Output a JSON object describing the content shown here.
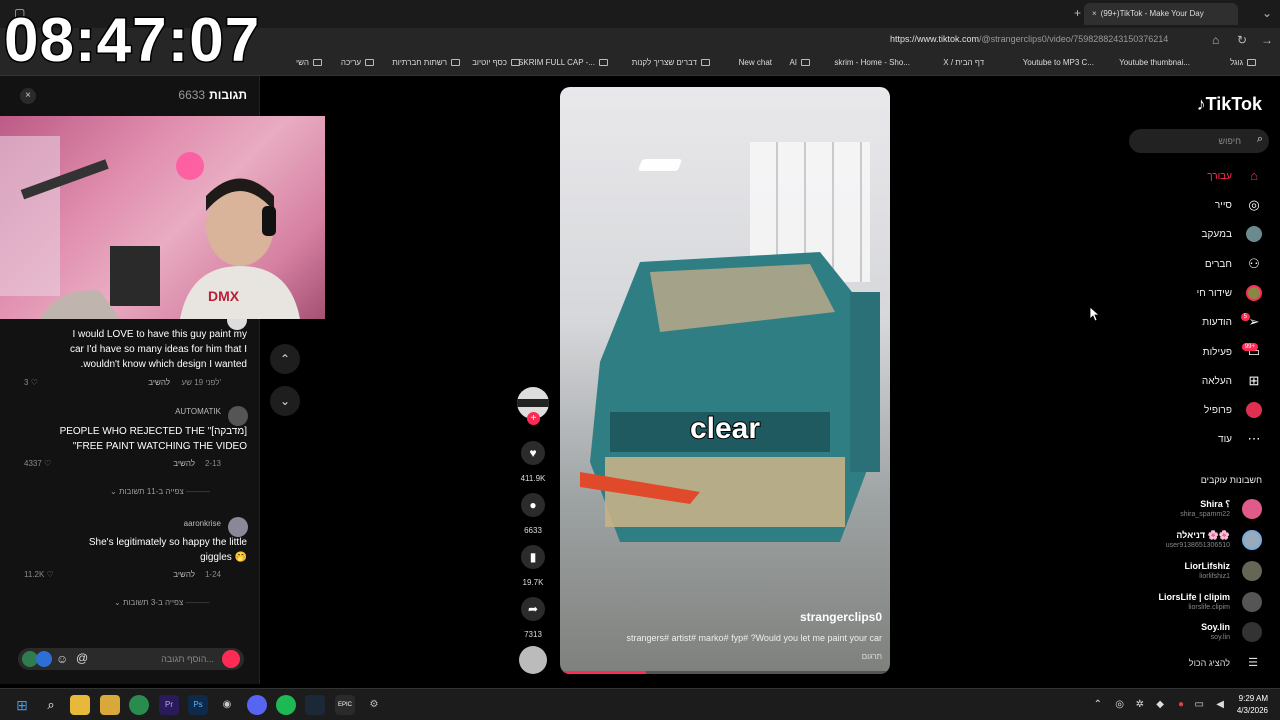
{
  "clock": "08:47:07",
  "browser": {
    "tab_title": "(99+)TikTok - Make Your Day",
    "url_host": "https://www.tiktok.com",
    "url_path": "/@strangerclips0/video/7598288243150376214",
    "bookmarks": [
      "גוגל",
      "Youtube thumbnai...",
      "Youtube to MP3 C...",
      "X / דף הבית",
      "skrim - Home - Sho...",
      "AI",
      "New chat",
      "דברים שצריך לקנות",
      "SKRIM FULL CAP -...",
      "כסף יוטיוב",
      "רשתות חברתיות",
      "עריכה",
      "השי"
    ]
  },
  "comments": {
    "title": "תגובות",
    "count": "6633",
    "close": "×",
    "items": [
      {
        "text_lines": [
          "I would LOVE to have this guy paint my",
          "car I'd have so many ideas for him that I",
          ".wouldn't know which design I wanted"
        ],
        "time": "לפני 19 שע'",
        "reply": "להשיב",
        "likes": "3"
      },
      {
        "user": "AUTOMATIK",
        "text_lines": [
          "PEOPLE WHO REJECTED THE \"[מדבקה]",
          "\"FREE PAINT WATCHING THE VIDEO"
        ],
        "time": "2-13",
        "reply": "להשיב",
        "likes": "4337",
        "replies": "צפייה ב-11 תשובות"
      },
      {
        "user": "aaronkrise",
        "text_lines": [
          "She's legitimately so happy the little",
          "giggles 🤭"
        ],
        "time": "1-24",
        "reply": "להשיב",
        "likes": "11.2K",
        "replies": "צפייה ב-3 תשובות"
      }
    ],
    "input_placeholder": "הוסף תגובה..."
  },
  "video": {
    "caption_overlay": "clear",
    "author": "strangerclips0",
    "description": "strangers# artist# marko# fyp# ?Would you let me paint your car",
    "translate": "תרגום",
    "progress": 0.26
  },
  "actions": {
    "likes": "411.9K",
    "comments": "6633",
    "saves": "19.7K",
    "shares": "7313"
  },
  "sidebar": {
    "logo": "TikTok",
    "search_placeholder": "חיפוש",
    "nav": [
      {
        "label": "עבורך",
        "icon": "home-icon",
        "active": true
      },
      {
        "label": "סייר",
        "icon": "compass-icon"
      },
      {
        "label": "במעקב",
        "icon": "following-icon"
      },
      {
        "label": "חברים",
        "icon": "friends-icon"
      },
      {
        "label": "שידור חי",
        "icon": "live-icon"
      },
      {
        "label": "הודעות",
        "icon": "messages-icon",
        "badge": "5"
      },
      {
        "label": "פעילות",
        "icon": "activity-icon",
        "badge": "99+"
      },
      {
        "label": "העלאה",
        "icon": "upload-icon"
      },
      {
        "label": "פרופיל",
        "icon": "profile-icon"
      },
      {
        "label": "עוד",
        "icon": "more-icon"
      }
    ],
    "following_title": "חשבונות עוקבים",
    "following": [
      {
        "name": "Shira ؟",
        "handle": "shira_spamm22"
      },
      {
        "name": "דניאלה 🌸🌸",
        "handle": "user9138651306510"
      },
      {
        "name": "LiorLifshiz",
        "handle": "liorlifshiz1"
      },
      {
        "name": "LiorsLife | clipim",
        "handle": "liorslife.clipim"
      },
      {
        "name": "Soy.lin",
        "handle": "soy.lin"
      }
    ],
    "show_all": "להציג הכול"
  },
  "taskbar": {
    "time": "9:29 AM",
    "date": "4/3/2026"
  },
  "colors": {
    "accent": "#fe2c55",
    "background": "#000000",
    "panel": "#121212"
  }
}
